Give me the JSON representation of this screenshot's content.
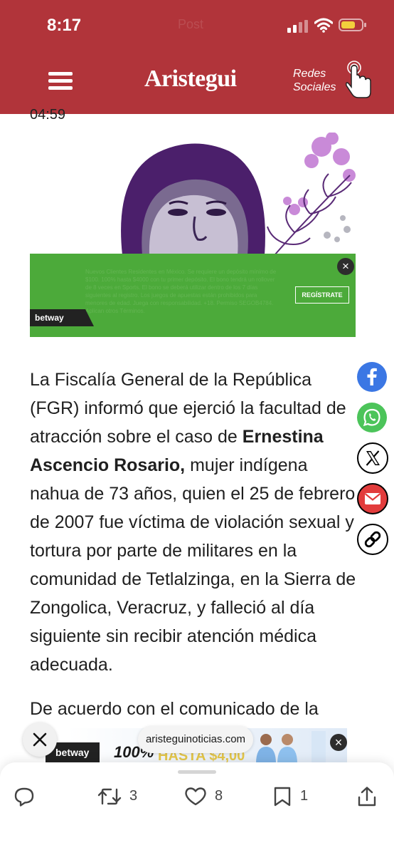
{
  "status_bar": {
    "time": "8:17",
    "faint_title": "Post"
  },
  "header": {
    "logo": "Aristegui",
    "redes_line1": "Redes",
    "redes_line2": "Sociales",
    "background_color": "#b1343a"
  },
  "timestamp": "04:59",
  "top_ad": {
    "fine_print": "Nuevos Clientes Residentes en México. Se requiere un depósito mínimo de $100. 100% hasta $4000 con tu primer depósito. El bono tendrá un rollover de 8 veces en Sports. El bono se deberá utilizar dentro de los 7 días siguientes al registro. Los juegos de apuestas están prohibidos para menores de edad. Juega con responsabilidad. +18. Permiso SEGOB4784. Aplican otros Términos.",
    "register_label": "REGÍSTRATE",
    "brand": "betway",
    "close": "×",
    "green_color": "#4caa3a"
  },
  "article": {
    "p1_before": "La Fiscalía General de la República (FGR) informó que ejerció la facultad de atracción sobre el caso de ",
    "p1_bold": "Ernestina Ascencio Rosario,",
    "p1_after": " mujer indígena nahua de 73 años, quien el 25 de febrero de 2007 fue víctima de violación sexual y tortura por parte de militares en la comunidad de Tetlalzinga, en la Sierra de Zongolica, Veracruz, y falleció al día siguiente sin recibir atención médica adecuada.",
    "p2": "De acuerdo con el comunicado de la"
  },
  "share_buttons": [
    {
      "icon": "facebook-icon",
      "color": "#3b77e4"
    },
    {
      "icon": "whatsapp-icon",
      "color": "#4cc45a"
    },
    {
      "icon": "x-icon",
      "color": "#000000"
    },
    {
      "icon": "mail-icon",
      "color": "#e23c3c"
    },
    {
      "icon": "link-icon",
      "color": "#000000"
    }
  ],
  "bottom_ad": {
    "brand": "betway",
    "headline": "100%",
    "hasta": "HASTA $4,00",
    "close": "×"
  },
  "url_pill": "aristeguinoticias.com",
  "float_close": "×",
  "actions": {
    "reply_icon": "comment-icon",
    "retweets": "3",
    "likes": "8",
    "bookmarks": "1",
    "share_icon": "share-icon"
  }
}
